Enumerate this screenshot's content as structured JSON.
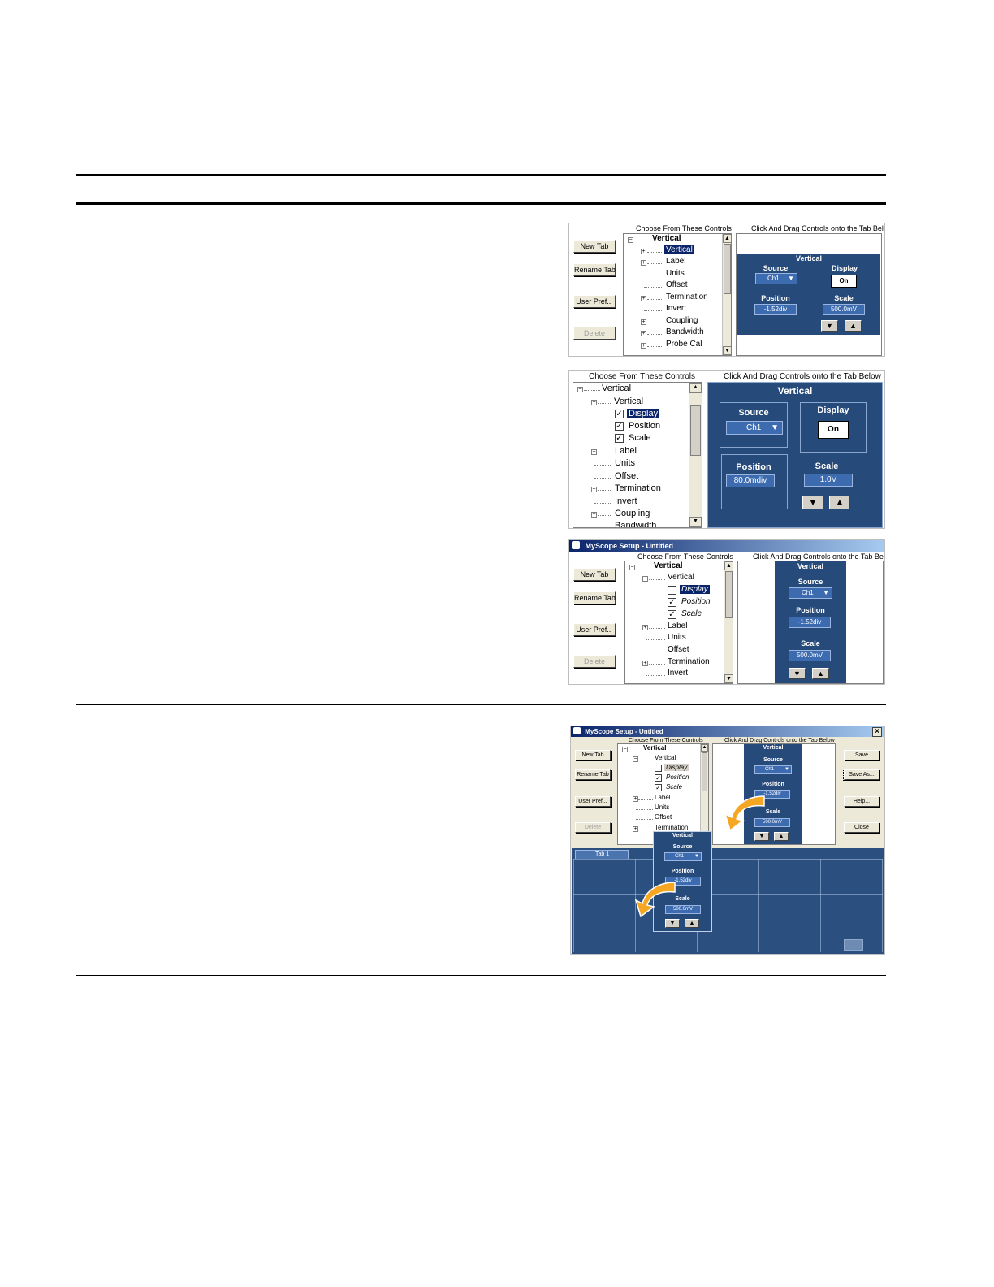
{
  "panels": {
    "choose_caption": "Choose From These Controls",
    "drag_caption": "Click And Drag Controls onto the Tab Below",
    "buttons": {
      "new_tab": "New Tab",
      "rename_tab": "Rename Tab",
      "user_pref": "User Pref...",
      "delete": "Delete",
      "save": "Save",
      "save_as": "Save As...",
      "help": "Help...",
      "close": "Close"
    },
    "window_title": "MyScope Setup - Untitled",
    "close_glyph": "×",
    "tree": {
      "vertical": "Vertical",
      "label": "Label",
      "units": "Units",
      "offset": "Offset",
      "termination": "Termination",
      "invert": "Invert",
      "coupling": "Coupling",
      "bandwidth": "Bandwidth",
      "probe_cal": "Probe Cal",
      "display": "Display",
      "position": "Position",
      "scale": "Scale",
      "bandwidth_partial": "Bandwidth"
    },
    "control": {
      "title": "Vertical",
      "source_label": "Source",
      "display_label": "Display",
      "position_label": "Position",
      "scale_label": "Scale",
      "source_value": "Ch1",
      "display_value": "On",
      "position_value_a": "-1.52div",
      "scale_value_a": "500.0mV",
      "position_value_b": "80.0mdiv",
      "scale_value_b": "1.0V",
      "position_value_d": "-1.52div",
      "scale_value_d": "500.0mV",
      "down_glyph": "▼",
      "up_glyph": "▲"
    },
    "tab_label": "Tab 1",
    "plus": "+",
    "minus": "−",
    "check": "✓",
    "scroll_up": "▲",
    "scroll_down": "▼"
  }
}
